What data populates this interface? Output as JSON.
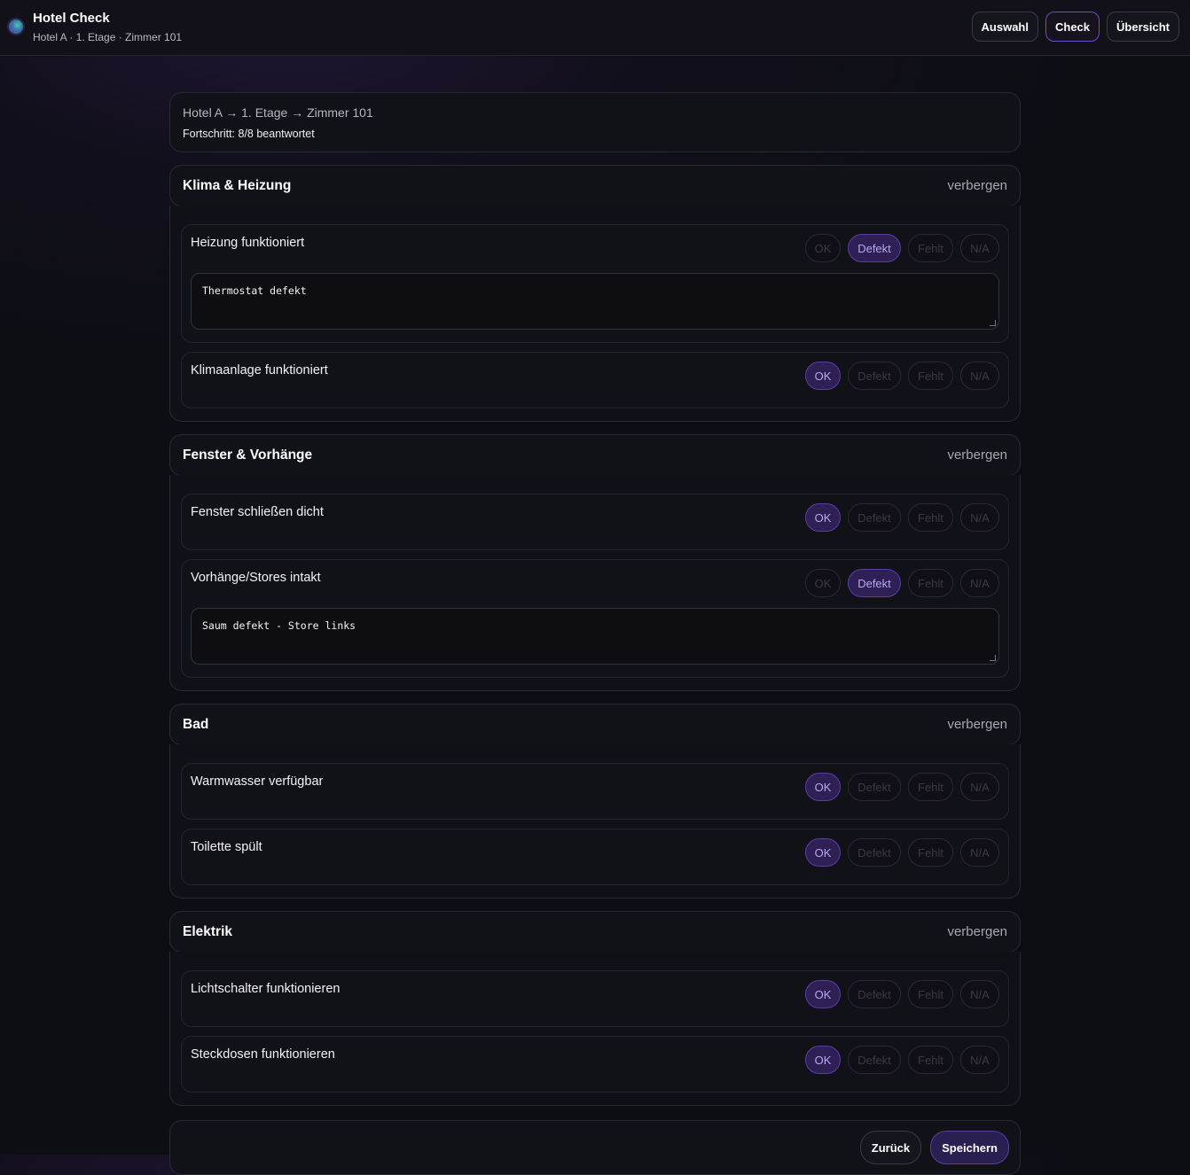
{
  "header": {
    "title": "Hotel Check",
    "subtitle": "Hotel A · 1. Etage · Zimmer 101",
    "nav": [
      {
        "label": "Auswahl",
        "active": false
      },
      {
        "label": "Check",
        "active": true
      },
      {
        "label": "Übersicht",
        "active": false
      }
    ]
  },
  "info": {
    "path": "Hotel A → 1. Etage → Zimmer 101",
    "progress": "Fortschritt: 8/8 beantwortet"
  },
  "options": [
    "OK",
    "Defekt",
    "Fehlt",
    "N/A"
  ],
  "toggle_label": "verbergen",
  "sections": [
    {
      "title": "Klima & Heizung",
      "items": [
        {
          "label": "Heizung funktioniert",
          "selected": "Defekt",
          "note": "Thermostat defekt"
        },
        {
          "label": "Klimaanlage funktioniert",
          "selected": "OK"
        }
      ]
    },
    {
      "title": "Fenster & Vorhänge",
      "items": [
        {
          "label": "Fenster schließen dicht",
          "selected": "OK"
        },
        {
          "label": "Vorhänge/Stores intakt",
          "selected": "Defekt",
          "note": "Saum defekt - Store links"
        }
      ]
    },
    {
      "title": "Bad",
      "items": [
        {
          "label": "Warmwasser verfügbar",
          "selected": "OK"
        },
        {
          "label": "Toilette spült",
          "selected": "OK"
        }
      ]
    },
    {
      "title": "Elektrik",
      "items": [
        {
          "label": "Lichtschalter funktionieren",
          "selected": "OK"
        },
        {
          "label": "Steckdosen funktionieren",
          "selected": "OK"
        }
      ]
    }
  ],
  "footer": {
    "back_label": "Zurück",
    "save_label": "Speichern"
  },
  "colors": {
    "accent": "#5a3ea8",
    "selected_bg": "#2e1f55",
    "background": "#0d0e14"
  }
}
